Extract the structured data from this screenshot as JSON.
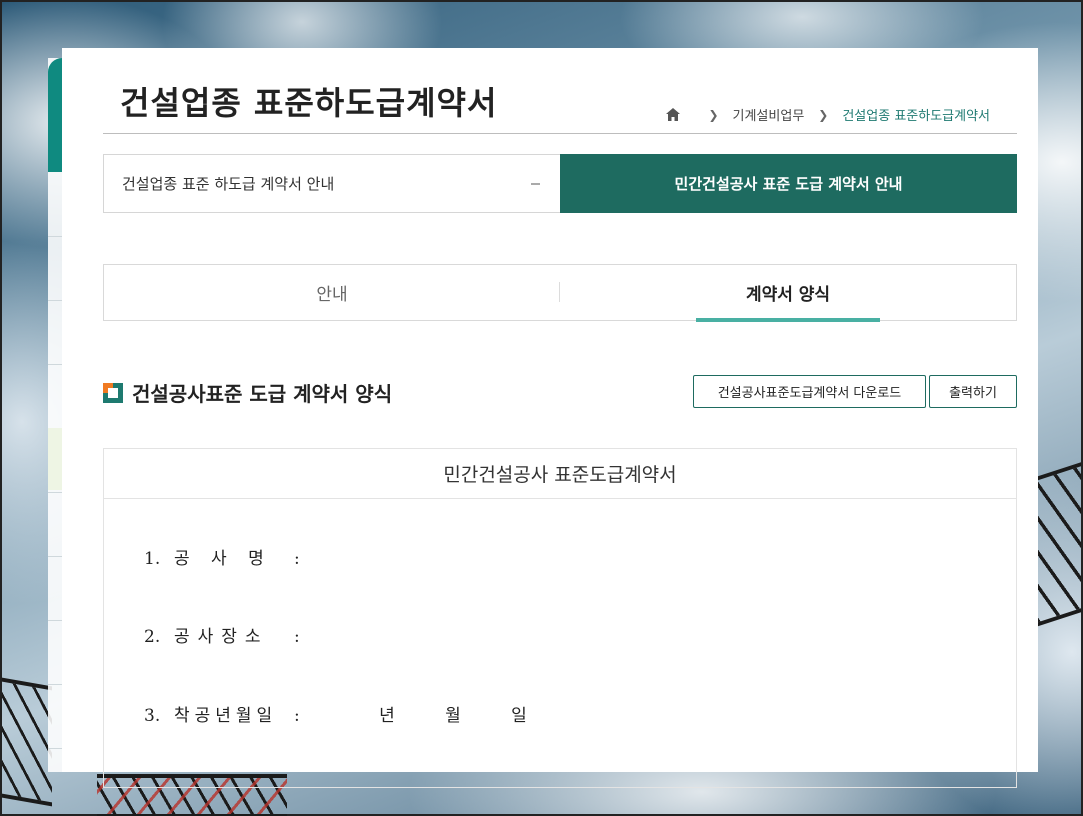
{
  "page": {
    "title": "건설업종 표준하도급계약서"
  },
  "breadcrumb": {
    "items": [
      "기계설비업무",
      "건설업종 표준하도급계약서"
    ]
  },
  "nav": {
    "left_label": "건설업종 표준 하도급 계약서 안내",
    "right_label": "민간건설공사 표준 도급 계약서 안내"
  },
  "subtabs": [
    {
      "label": "안내",
      "active": false
    },
    {
      "label": "계약서 양식",
      "active": true
    }
  ],
  "section": {
    "title": "건설공사표준 도급 계약서 양식",
    "download_label": "건설공사표준도급계약서 다운로드",
    "print_label": "출력하기"
  },
  "document": {
    "title": "민간건설공사 표준도급계약서",
    "rows": [
      {
        "num": "1.",
        "label": "공 사 명",
        "colon": ":"
      },
      {
        "num": "2.",
        "label": "공사장소",
        "colon": ":"
      },
      {
        "num": "3.",
        "label": "착공년월일",
        "colon": ":",
        "year": "년",
        "month": "월",
        "day": "일"
      }
    ]
  },
  "colors": {
    "accent_dark": "#1e6b60",
    "accent_light": "#49b0a3",
    "breadcrumb_current": "#1f7a72",
    "icon_orange": "#f07a22"
  }
}
